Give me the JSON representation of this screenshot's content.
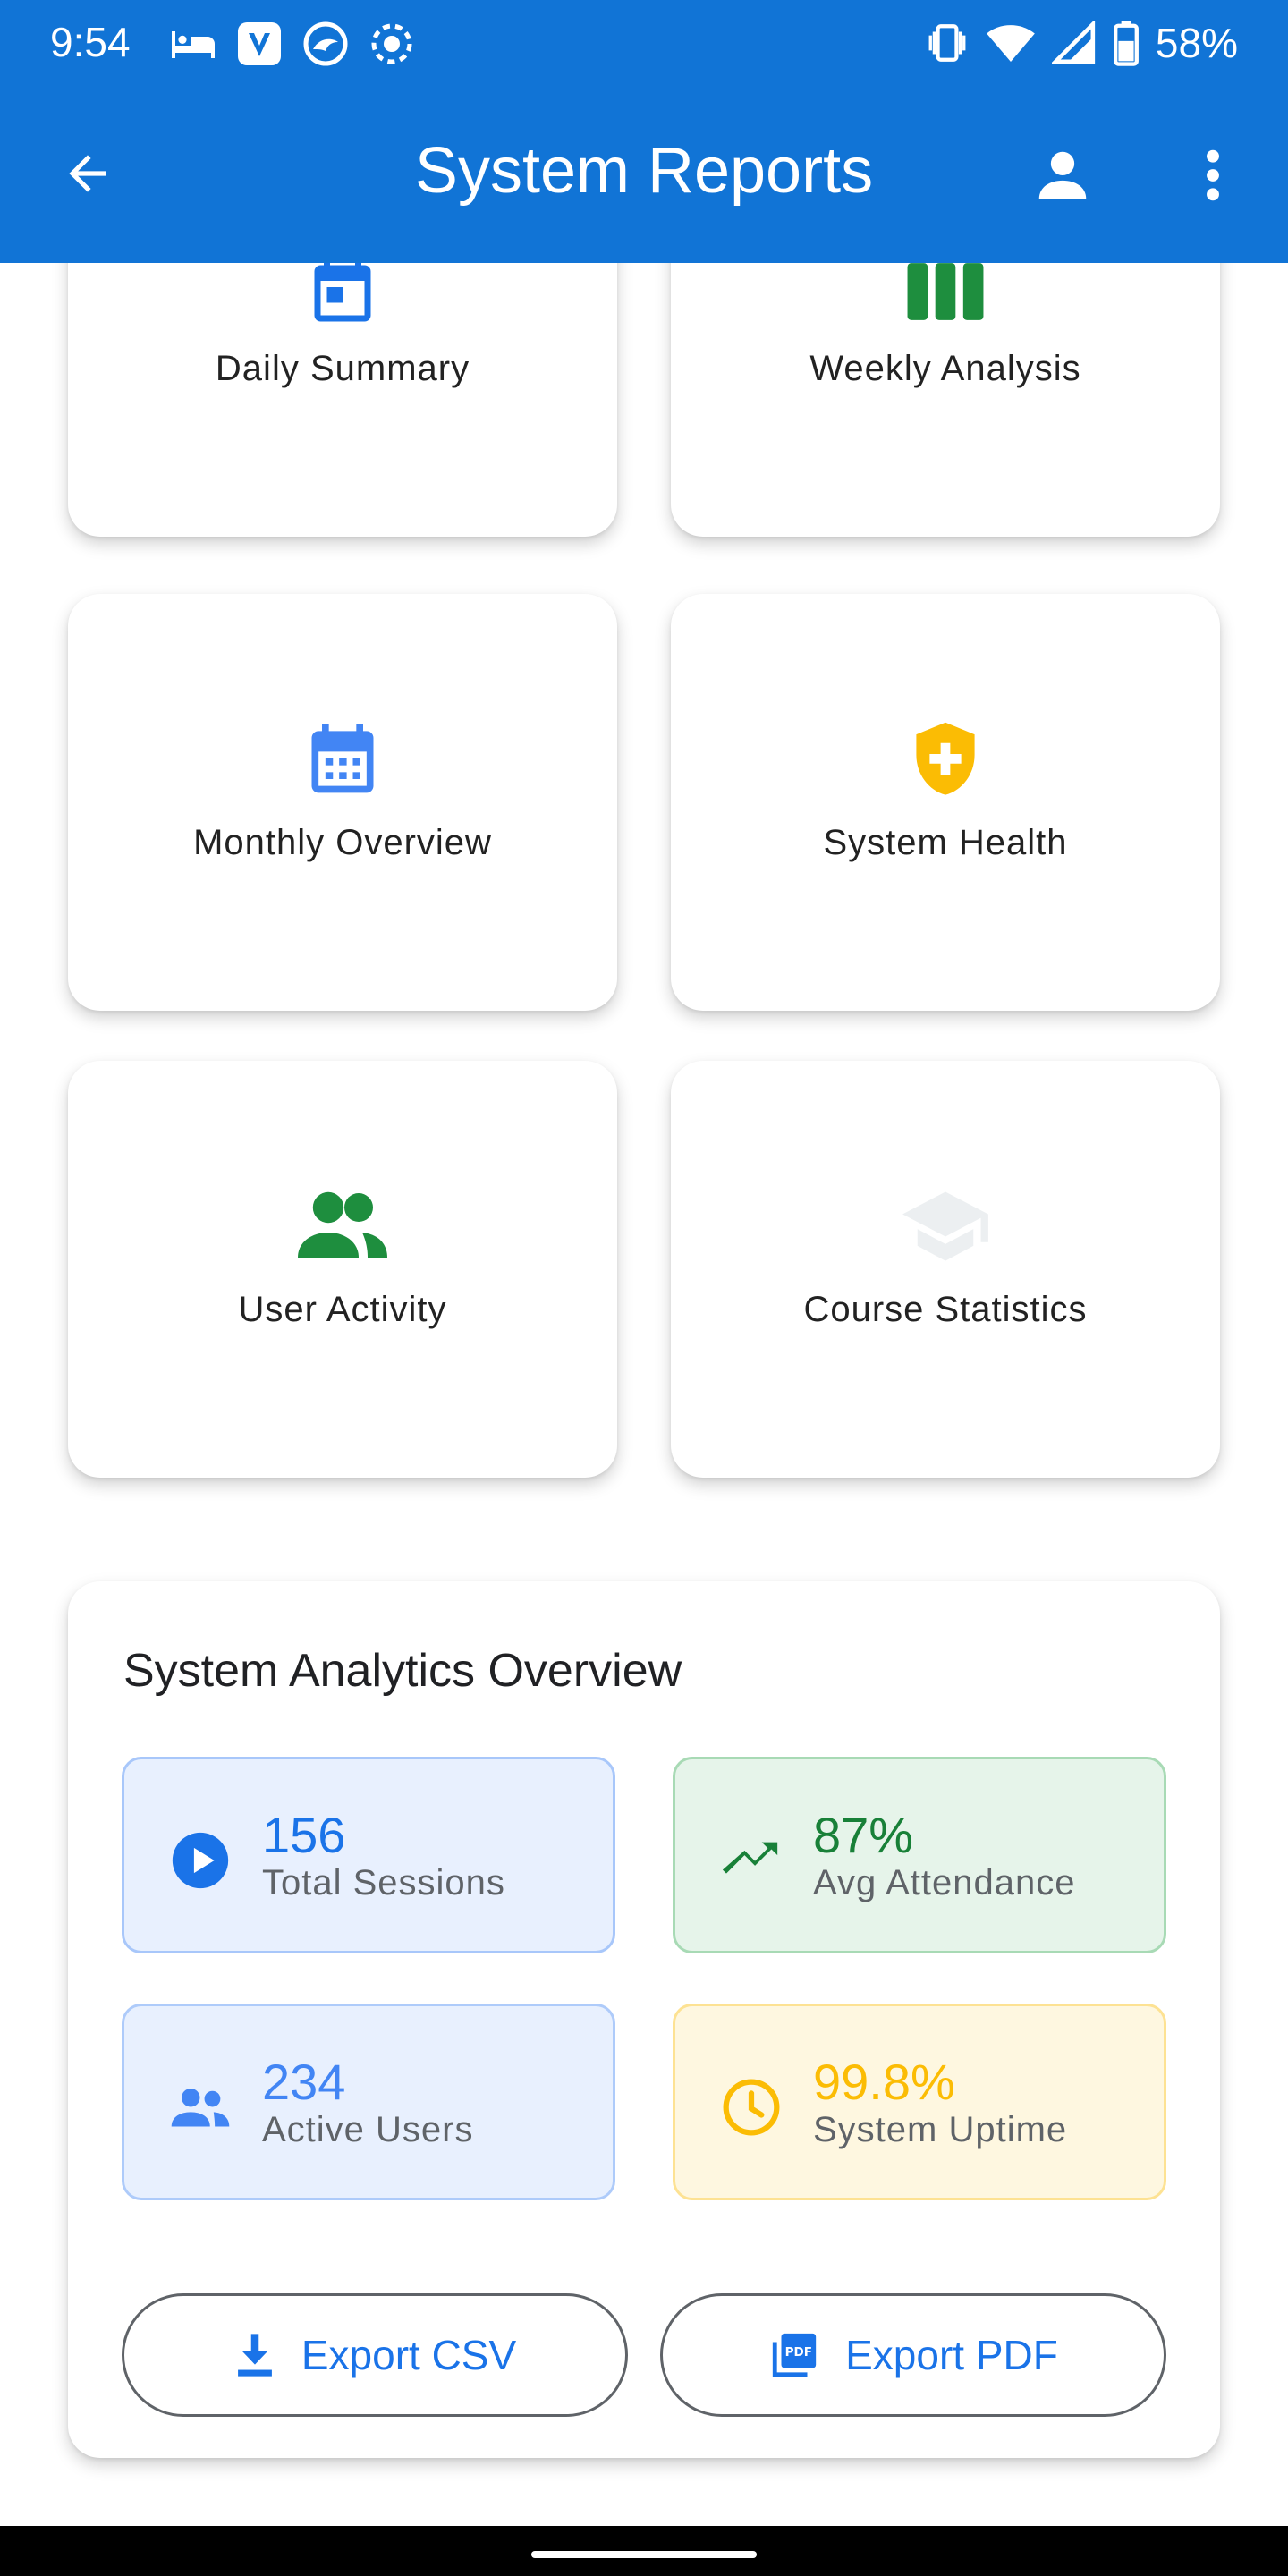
{
  "status_bar": {
    "time": "9:54",
    "battery": "58%"
  },
  "app_bar": {
    "title": "System Reports"
  },
  "report_cards": [
    {
      "label": "Daily Summary",
      "icon": "calendar-day-icon",
      "color": "#1a73e8"
    },
    {
      "label": "Weekly Analysis",
      "icon": "view-week-icon",
      "color": "#1e8e3e"
    },
    {
      "label": "Monthly Overview",
      "icon": "calendar-month-icon",
      "color": "#4285f4"
    },
    {
      "label": "System Health",
      "icon": "health-shield-icon",
      "color": "#fbbc04"
    },
    {
      "label": "User Activity",
      "icon": "people-icon",
      "color": "#1e8e3e"
    },
    {
      "label": "Course Statistics",
      "icon": "school-icon",
      "color": "#f1f3f4"
    }
  ],
  "analytics": {
    "title": "System Analytics Overview",
    "stats": [
      {
        "value": "156",
        "label": "Total Sessions",
        "icon": "play-circle-icon",
        "color": "#1a73e8",
        "bg": "#e8f0fe",
        "border": "#a8c7fa"
      },
      {
        "value": "87%",
        "label": "Avg Attendance",
        "icon": "trending-up-icon",
        "color": "#188038",
        "bg": "#e6f4ea",
        "border": "#a8dab5"
      },
      {
        "value": "234",
        "label": "Active Users",
        "icon": "group-icon",
        "color": "#4285f4",
        "bg": "#e8f0fe",
        "border": "#aecbfa"
      },
      {
        "value": "99.8%",
        "label": "System Uptime",
        "icon": "clock-icon",
        "color": "#fbbc04",
        "bg": "#fef7e0",
        "border": "#fde293"
      }
    ],
    "export_csv": "Export CSV",
    "export_pdf": "Export PDF"
  }
}
